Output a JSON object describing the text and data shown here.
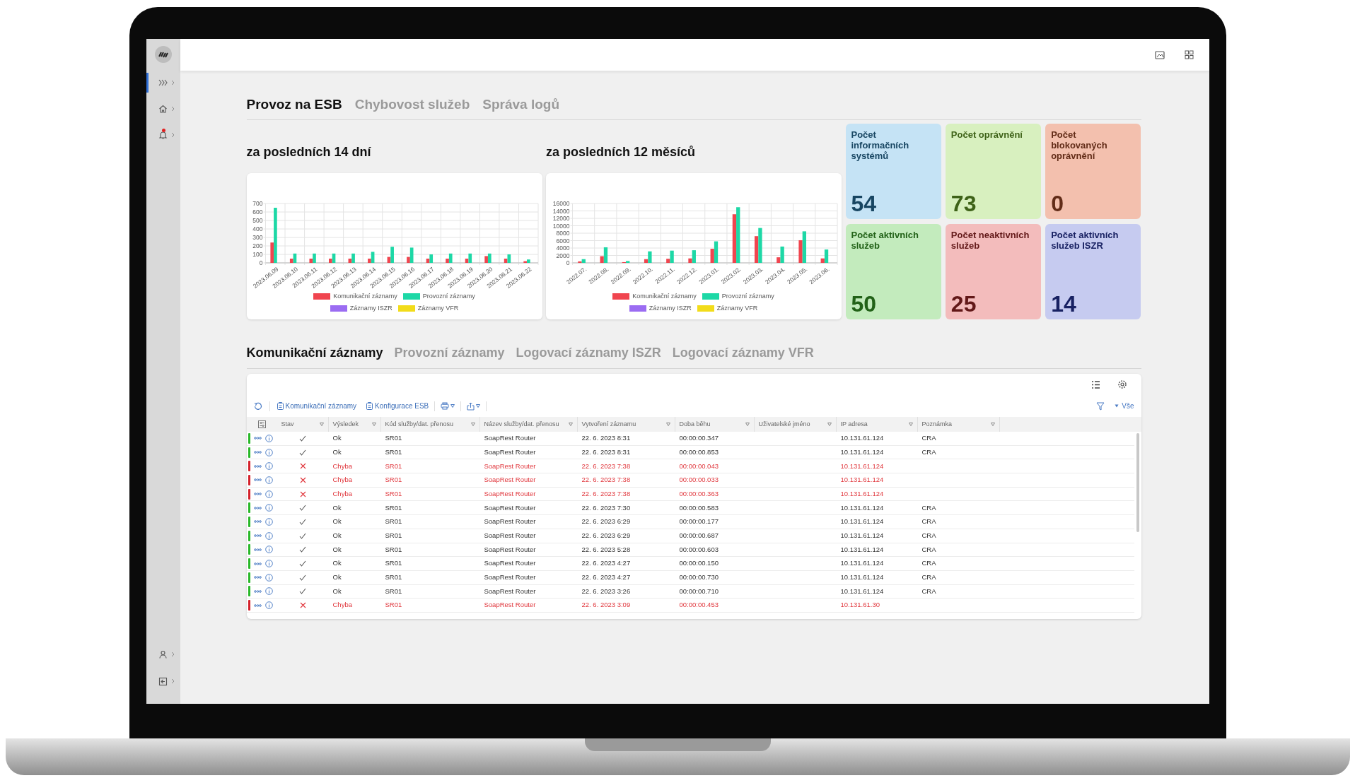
{
  "sidebar": {
    "items": [
      {
        "selected": true,
        "badge": false
      },
      {
        "selected": false,
        "badge": false
      },
      {
        "selected": false,
        "badge": true
      }
    ]
  },
  "main_tabs": [
    {
      "label": "Provoz na ESB",
      "selected": true
    },
    {
      "label": "Chybovost služeb",
      "selected": false
    },
    {
      "label": "Správa logů",
      "selected": false
    }
  ],
  "charts": [
    {
      "heading": "za posledních 14 dní",
      "chart_data": {
        "type": "bar",
        "categories": [
          "2023.06.09",
          "2023.06.10",
          "2023.06.11",
          "2023.06.12",
          "2023.06.13",
          "2023.06.14",
          "2023.06.15",
          "2023.06.16",
          "2023.06.17",
          "2023.06.18",
          "2023.06.19",
          "2023.06.20",
          "2023.06.21",
          "2023.06.22"
        ],
        "yticks": [
          0,
          100,
          200,
          300,
          400,
          500,
          600,
          700
        ],
        "ylim": [
          0,
          700
        ],
        "grid": true,
        "legend": "bottom",
        "series": [
          {
            "name": "Komunikační záznamy",
            "color": "#f0454f",
            "values": [
              240,
              50,
              50,
              50,
              50,
              50,
              70,
              70,
              50,
              50,
              50,
              80,
              50,
              20
            ]
          },
          {
            "name": "Provozní záznamy",
            "color": "#1dd8a6",
            "values": [
              650,
              110,
              110,
              110,
              110,
              130,
              190,
              180,
              100,
              110,
              110,
              110,
              100,
              40
            ]
          },
          {
            "name": "Záznamy ISZR",
            "color": "#9b6cf2",
            "values": [
              null,
              null,
              null,
              null,
              null,
              null,
              null,
              null,
              null,
              null,
              null,
              null,
              null,
              null
            ]
          },
          {
            "name": "Záznamy VFR",
            "color": "#f2dc1a",
            "values": [
              null,
              null,
              null,
              null,
              null,
              null,
              null,
              null,
              null,
              null,
              null,
              null,
              null,
              null
            ]
          }
        ]
      }
    },
    {
      "heading": "za posledních 12 měsíců",
      "chart_data": {
        "type": "bar",
        "categories": [
          "2022.07.",
          "2022.08.",
          "2022.09.",
          "2022.10.",
          "2022.11.",
          "2022.12.",
          "2023.01.",
          "2023.02.",
          "2023.03.",
          "2023.04.",
          "2023.05.",
          "2023.06."
        ],
        "yticks": [
          0,
          2000,
          4000,
          6000,
          8000,
          10000,
          12000,
          14000,
          16000
        ],
        "ylim": [
          0,
          16000
        ],
        "grid": true,
        "legend": "bottom",
        "series": [
          {
            "name": "Komunikační záznamy",
            "color": "#f0454f",
            "values": [
              400,
              1800,
              200,
              1000,
              1100,
              1200,
              3800,
              13100,
              7200,
              1500,
              6100,
              1200
            ]
          },
          {
            "name": "Provozní záznamy",
            "color": "#1dd8a6",
            "values": [
              1000,
              4200,
              500,
              3100,
              3300,
              3400,
              5800,
              15000,
              9400,
              4400,
              8500,
              3600
            ]
          },
          {
            "name": "Záznamy ISZR",
            "color": "#9b6cf2",
            "values": [
              null,
              null,
              null,
              null,
              null,
              null,
              null,
              null,
              null,
              null,
              null,
              null
            ]
          },
          {
            "name": "Záznamy VFR",
            "color": "#f2dc1a",
            "values": [
              null,
              null,
              null,
              null,
              null,
              null,
              null,
              null,
              null,
              null,
              null,
              null
            ]
          }
        ]
      }
    }
  ],
  "stat_cards": [
    {
      "title": "Počet informačních systémů",
      "value": "54",
      "color": "#c5e3f5"
    },
    {
      "title": "Počet oprávnění",
      "value": "73",
      "color": "#d8f0bf"
    },
    {
      "title": "Počet blokovaných oprávnění",
      "value": "0",
      "color": "#f3c0ae"
    },
    {
      "title": "Počet aktivních služeb",
      "value": "50",
      "color": "#c3ebbd"
    },
    {
      "title": "Počet neaktivních služeb",
      "value": "25",
      "color": "#f3bcbc"
    },
    {
      "title": "Počet aktivních služeb ISZR",
      "value": "14",
      "color": "#c6cbf0"
    }
  ],
  "log_tabs": [
    {
      "label": "Komunikační záznamy",
      "selected": true
    },
    {
      "label": "Provozní záznamy",
      "selected": false
    },
    {
      "label": "Logovací záznamy ISZR",
      "selected": false
    },
    {
      "label": "Logovací záznamy VFR",
      "selected": false
    }
  ],
  "toolbar": {
    "buttons": [
      "Komunikační záznamy",
      "Konfigurace ESB"
    ],
    "filter_label": "Vše"
  },
  "table": {
    "columns": [
      "Stav",
      "Výsledek",
      "Kód služby/dat. přenosu",
      "Název služby/dat. přenosu",
      "Vytvoření záznamu",
      "Doba běhu",
      "Uživatelské jméno",
      "IP adresa",
      "Poznámka"
    ],
    "rows": [
      {
        "failed": false,
        "result": "Ok",
        "code": "SR01",
        "name": "SoapRest Router",
        "created": "22. 6. 2023 8:31",
        "duration": "00:00:00.347",
        "ip": "10.131.61.124",
        "note": "CRA"
      },
      {
        "failed": false,
        "result": "Ok",
        "code": "SR01",
        "name": "SoapRest Router",
        "created": "22. 6. 2023 8:31",
        "duration": "00:00:00.853",
        "ip": "10.131.61.124",
        "note": "CRA"
      },
      {
        "failed": true,
        "result": "Chyba",
        "code": "SR01",
        "name": "SoapRest Router",
        "created": "22. 6. 2023 7:38",
        "duration": "00:00:00.043",
        "ip": "10.131.61.124"
      },
      {
        "failed": true,
        "result": "Chyba",
        "code": "SR01",
        "name": "SoapRest Router",
        "created": "22. 6. 2023 7:38",
        "duration": "00:00:00.033",
        "ip": "10.131.61.124"
      },
      {
        "failed": true,
        "result": "Chyba",
        "code": "SR01",
        "name": "SoapRest Router",
        "created": "22. 6. 2023 7:38",
        "duration": "00:00:00.363",
        "ip": "10.131.61.124"
      },
      {
        "failed": false,
        "result": "Ok",
        "code": "SR01",
        "name": "SoapRest Router",
        "created": "22. 6. 2023 7:30",
        "duration": "00:00:00.583",
        "ip": "10.131.61.124",
        "note": "CRA"
      },
      {
        "failed": false,
        "result": "Ok",
        "code": "SR01",
        "name": "SoapRest Router",
        "created": "22. 6. 2023 6:29",
        "duration": "00:00:00.177",
        "ip": "10.131.61.124",
        "note": "CRA"
      },
      {
        "failed": false,
        "result": "Ok",
        "code": "SR01",
        "name": "SoapRest Router",
        "created": "22. 6. 2023 6:29",
        "duration": "00:00:00.687",
        "ip": "10.131.61.124",
        "note": "CRA"
      },
      {
        "failed": false,
        "result": "Ok",
        "code": "SR01",
        "name": "SoapRest Router",
        "created": "22. 6. 2023 5:28",
        "duration": "00:00:00.603",
        "ip": "10.131.61.124",
        "note": "CRA"
      },
      {
        "failed": false,
        "result": "Ok",
        "code": "SR01",
        "name": "SoapRest Router",
        "created": "22. 6. 2023 4:27",
        "duration": "00:00:00.150",
        "ip": "10.131.61.124",
        "note": "CRA"
      },
      {
        "failed": false,
        "result": "Ok",
        "code": "SR01",
        "name": "SoapRest Router",
        "created": "22. 6. 2023 4:27",
        "duration": "00:00:00.730",
        "ip": "10.131.61.124",
        "note": "CRA"
      },
      {
        "failed": false,
        "result": "Ok",
        "code": "SR01",
        "name": "SoapRest Router",
        "created": "22. 6. 2023 3:26",
        "duration": "00:00:00.710",
        "ip": "10.131.61.124",
        "note": "CRA"
      },
      {
        "failed": true,
        "result": "Chyba",
        "code": "SR01",
        "name": "SoapRest Router",
        "created": "22. 6. 2023 3:09",
        "duration": "00:00:00.453",
        "ip": "10.131.61.30"
      }
    ]
  }
}
